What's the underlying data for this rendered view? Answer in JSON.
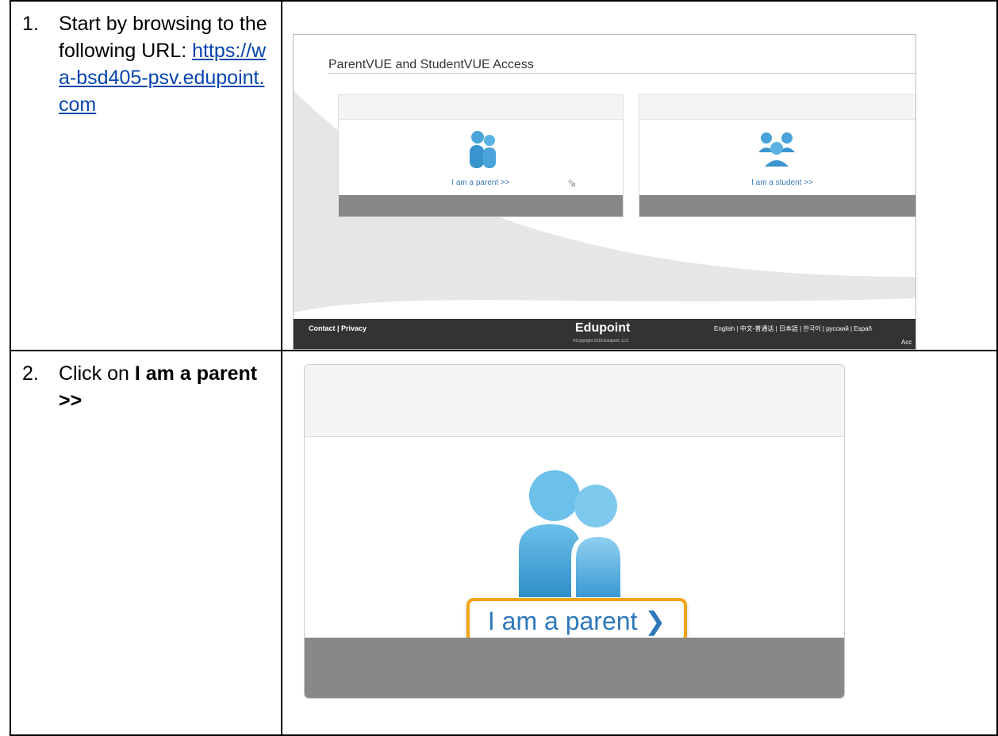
{
  "steps": [
    {
      "number": "1.",
      "text": "Start by browsing to the following URL: ",
      "url": "https://wa-bsd405-psv.edupoint.com",
      "screenshot": {
        "title": "ParentVUE and StudentVUE Access",
        "parent_label": "I am a parent >>",
        "student_label": "I am a student >>",
        "footer_links": "Contact | Privacy",
        "logo": "Edupoint",
        "copyright": "©Copyright 2018 Edupoint, LLC",
        "languages": "English | 中文-普通话 | 日本語 | 한국어 | русский | Españ",
        "footer_right": "Acc"
      }
    },
    {
      "number": "2.",
      "text": "Click on ",
      "bold": "I am a parent >>",
      "screenshot": {
        "highlight_label": "I am a parent",
        "highlight_color": "#f2a516"
      }
    }
  ],
  "colors": {
    "link": "#0645ad",
    "icon_blue": "#4aa3d9",
    "label_blue": "#3a7bbf"
  },
  "icons": [
    "parent-icon",
    "student-group-icon",
    "mouse-cursor-icon",
    "chevron-right-icon"
  ]
}
